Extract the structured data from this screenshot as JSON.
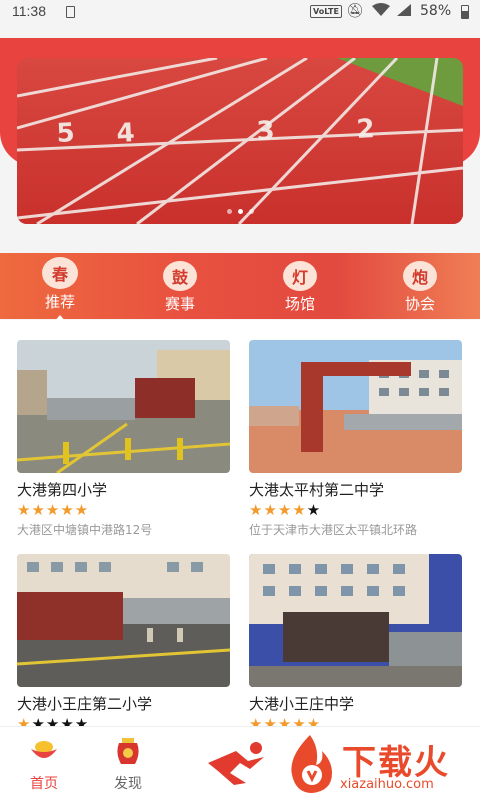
{
  "status_bar": {
    "time": "11:38",
    "network": "VoLTE",
    "battery": "58%"
  },
  "banner": {
    "dot_count": 3,
    "active_dot": 1
  },
  "categories": [
    {
      "label": "推荐",
      "icon": "spring-icon",
      "glyph": "春",
      "active": true
    },
    {
      "label": "赛事",
      "icon": "drum-icon",
      "glyph": "鼓",
      "active": false
    },
    {
      "label": "场馆",
      "icon": "lantern-icon",
      "glyph": "灯",
      "active": false
    },
    {
      "label": "协会",
      "icon": "firecracker-icon",
      "glyph": "炮",
      "active": false
    }
  ],
  "venues": [
    {
      "name": "大港第四小学",
      "rating": 5,
      "address": "大港区中塘镇中港路12号"
    },
    {
      "name": "大港太平村第二中学",
      "rating": 4,
      "address": "位于天津市大港区太平镇北环路"
    },
    {
      "name": "大港小王庄第二小学",
      "rating": 1,
      "address": ""
    },
    {
      "name": "大港小王庄中学",
      "rating": 5,
      "address": ""
    }
  ],
  "bottom_nav": [
    {
      "label": "首页",
      "active": true
    },
    {
      "label": "发现",
      "active": false
    }
  ],
  "watermark": {
    "title": "下载火",
    "url": "xiazaihuo.com"
  },
  "colors": {
    "brand_red": "#e9433f",
    "star_on": "#f29b2c",
    "star_off": "#111111"
  }
}
